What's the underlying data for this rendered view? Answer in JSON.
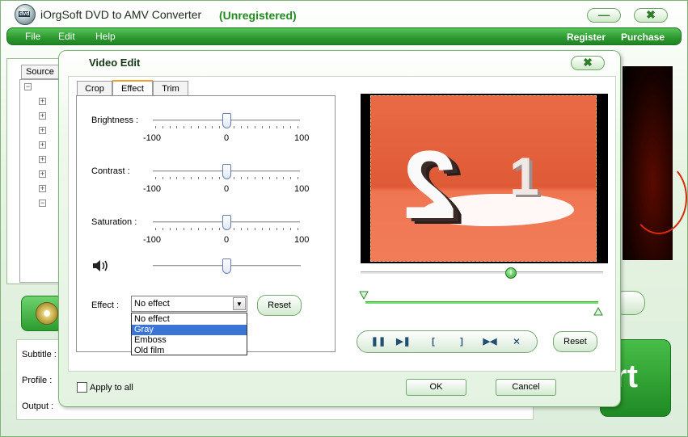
{
  "app": {
    "title": "iOrgSoft DVD to AMV Converter",
    "registration": "(Unregistered)",
    "icon_text": "dvd",
    "minimize_glyph": "—",
    "close_glyph": "✖"
  },
  "menu": {
    "file": "File",
    "edit": "Edit",
    "help": "Help",
    "register": "Register",
    "purchase": "Purchase"
  },
  "background": {
    "source_tab": "Source",
    "subtitle_label": "Subtitle :",
    "profile_label": "Profile :",
    "output_label": "Output :",
    "start_label": "rt"
  },
  "dialog": {
    "title": "Video Edit",
    "close_glyph": "✖",
    "tabs": [
      {
        "label": "Crop",
        "active": false
      },
      {
        "label": "Effect",
        "active": true
      },
      {
        "label": "Trim",
        "active": false
      }
    ],
    "sliders": [
      {
        "label": "Brightness :",
        "min": "-100",
        "mid": "0",
        "max": "100",
        "value": 0
      },
      {
        "label": "Contrast :",
        "min": "-100",
        "mid": "0",
        "max": "100",
        "value": 0
      },
      {
        "label": "Saturation :",
        "min": "-100",
        "mid": "0",
        "max": "100",
        "value": 0
      }
    ],
    "volume": {
      "icon": "speaker-icon",
      "value": 0.5
    },
    "effect": {
      "label": "Effect :",
      "selected": "No effect",
      "options": [
        "No effect",
        "Gray",
        "Emboss",
        "Old film"
      ],
      "highlighted": "Gray"
    },
    "reset_label": "Reset",
    "apply_to_all": "Apply to all",
    "ok": "OK",
    "cancel": "Cancel",
    "preview": {
      "digits_left": "2",
      "digits_right": "1",
      "seek_position": 0.62,
      "seek_glyph": "i"
    },
    "controls": {
      "pause": "❚❚",
      "step": "▶❚",
      "mark_in": "[",
      "mark_out": "]",
      "jump": "▶◀",
      "split": "⨯",
      "reset": "Reset"
    }
  },
  "colors": {
    "accent_green": "#2e9a31",
    "selection_blue": "#3a75d6",
    "preview_orange": "#e96b45"
  }
}
